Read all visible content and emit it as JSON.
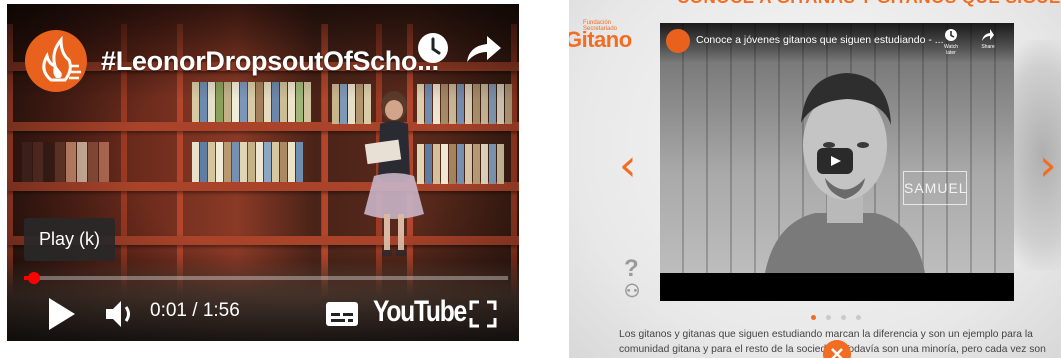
{
  "left_player": {
    "title": "#LeonorDropsoutOfScho...",
    "tooltip": "Play (k)",
    "time": "0:01 / 1:56",
    "logo_text": "YouTube",
    "progress_fraction": 0.02,
    "icons": {
      "watch_later": "clock-icon",
      "share": "share-arrow-icon",
      "play": "play-icon",
      "volume": "volume-icon",
      "captions": "subtitles-icon",
      "fullscreen": "fullscreen-icon"
    },
    "colors": {
      "progress": "#ff0000",
      "channel_avatar": "#e8621e"
    }
  },
  "right_page": {
    "top_heading": "CONOCE A GITANAS Y GITANOS QUE SIGUEN ESTUDIANDO",
    "brand": {
      "tag_line1": "Fundación",
      "tag_line2": "Secretariado",
      "word": "Gitano"
    },
    "carousel": {
      "prev": "‹",
      "next": "›",
      "slides": 4,
      "active_slide": 1
    },
    "embed": {
      "title": "Conoce a jóvenes gitanos que siguen estudiando - ...",
      "watch_later_label": "Watch later",
      "share_label": "Share",
      "name_tag": "SAMUEL"
    },
    "description": "Los gitanos y gitanas que siguen estudiando marcan la diferencia y son un ejemplo para la comunidad gitana y para el resto de la sociedad. Todavía son una minoría, pero cada vez son más.",
    "colors": {
      "accent": "#f26d21"
    }
  }
}
